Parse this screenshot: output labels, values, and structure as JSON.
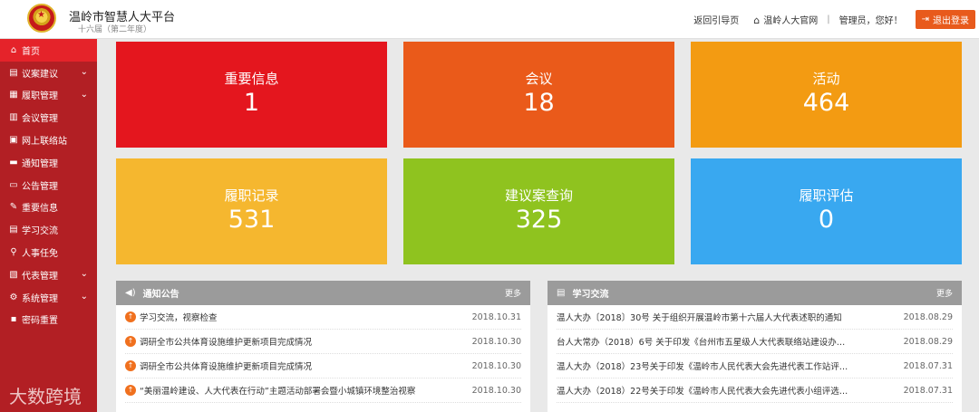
{
  "header": {
    "title": "温岭市智慧人大平台",
    "subtitle": "十六届（第二年度）",
    "back_link": "返回引导页",
    "site_link": "温岭人大官网",
    "separator": "|",
    "user_greeting": "管理员，您好！",
    "logout": "退出登录"
  },
  "sidebar": {
    "items": [
      {
        "label": "首页"
      },
      {
        "label": "议案建议"
      },
      {
        "label": "履职管理"
      },
      {
        "label": "会议管理"
      },
      {
        "label": "网上联络站"
      },
      {
        "label": "通知管理"
      },
      {
        "label": "公告管理"
      },
      {
        "label": "重要信息"
      },
      {
        "label": "学习交流"
      },
      {
        "label": "人事任免"
      },
      {
        "label": "代表管理"
      },
      {
        "label": "系统管理"
      },
      {
        "label": "密码重置"
      }
    ]
  },
  "tiles": [
    {
      "label": "重要信息",
      "value": "1",
      "color": "#e4161e"
    },
    {
      "label": "会议",
      "value": "18",
      "color": "#ea5a1a"
    },
    {
      "label": "活动",
      "value": "464",
      "color": "#f39b12"
    },
    {
      "label": "履职记录",
      "value": "531",
      "color": "#f5b72f"
    },
    {
      "label": "建议案查询",
      "value": "325",
      "color": "#8fc31f"
    },
    {
      "label": "履职评估",
      "value": "0",
      "color": "#39a8f0"
    }
  ],
  "notice_panel": {
    "title": "通知公告",
    "more": "更多",
    "rows": [
      {
        "text": "学习交流，视察检查",
        "date": "2018.10.31"
      },
      {
        "text": "调研全市公共体育设施维护更新项目完成情况",
        "date": "2018.10.30"
      },
      {
        "text": "调研全市公共体育设施维护更新项目完成情况",
        "date": "2018.10.30"
      },
      {
        "text": "“美丽温岭建设、人大代表在行动”主题活动部署会暨小城镇环境整治视察",
        "date": "2018.10.30"
      }
    ]
  },
  "study_panel": {
    "title": "学习交流",
    "more": "更多",
    "rows": [
      {
        "text": "温人大办〔2018〕30号 关于组织开展温岭市第十六届人大代表述职的通知",
        "date": "2018.08.29"
      },
      {
        "text": "台人大常办（2018）6号 关于印发《台州市五星级人大代表联络站建设办…",
        "date": "2018.08.29"
      },
      {
        "text": "温人大办（2018）23号关于印发《温岭市人民代表大会先进代表工作站评…",
        "date": "2018.07.31"
      },
      {
        "text": "温人大办（2018）22号关于印发《温岭市人民代表大会先进代表小组评选…",
        "date": "2018.07.31"
      }
    ]
  },
  "watermark": "大数跨境"
}
